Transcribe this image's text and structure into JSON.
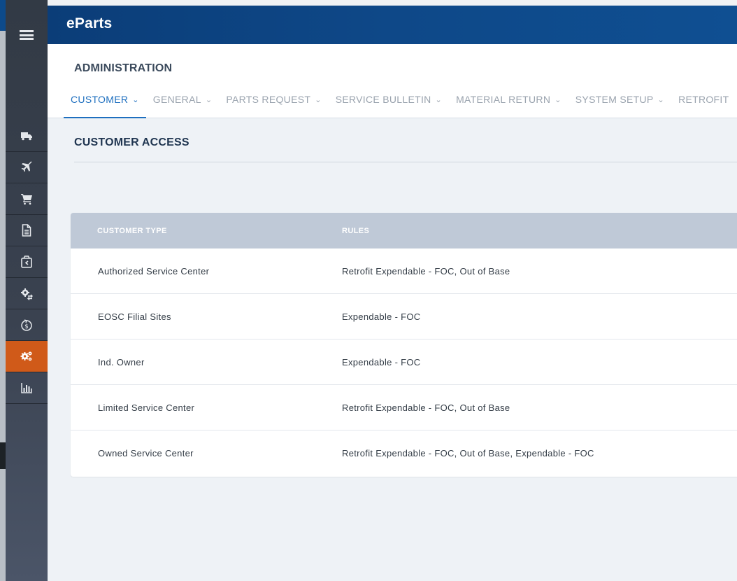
{
  "app": {
    "brand": "eParts"
  },
  "sidebar": {
    "menu_icon": "hamburger-icon",
    "items": [
      {
        "icon": "truck-icon",
        "active": false
      },
      {
        "icon": "airplane-icon",
        "active": false
      },
      {
        "icon": "cart-icon",
        "active": false
      },
      {
        "icon": "document-icon",
        "active": false
      },
      {
        "icon": "box-return-icon",
        "active": false
      },
      {
        "icon": "gear-exchange-icon",
        "active": false
      },
      {
        "icon": "dollar-cycle-icon",
        "active": false
      },
      {
        "icon": "gears-icon",
        "active": true
      },
      {
        "icon": "bar-chart-icon",
        "active": false
      }
    ],
    "active_color": "#d05a19"
  },
  "admin": {
    "title": "ADMINISTRATION",
    "tabs": [
      {
        "label": "CUSTOMER",
        "active": true
      },
      {
        "label": "GENERAL",
        "active": false
      },
      {
        "label": "PARTS REQUEST",
        "active": false
      },
      {
        "label": "SERVICE BULLETIN",
        "active": false
      },
      {
        "label": "MATERIAL RETURN",
        "active": false
      },
      {
        "label": "SYSTEM SETUP",
        "active": false
      },
      {
        "label": "RETROFIT",
        "active": false
      }
    ]
  },
  "section": {
    "title": "CUSTOMER ACCESS"
  },
  "table": {
    "headers": {
      "customer_type": "CUSTOMER TYPE",
      "rules": "RULES"
    },
    "rows": [
      {
        "customer_type": "Authorized Service Center",
        "rules": "Retrofit Expendable - FOC, Out of Base"
      },
      {
        "customer_type": "EOSC Filial Sites",
        "rules": "Expendable - FOC"
      },
      {
        "customer_type": "Ind. Owner",
        "rules": "Expendable - FOC"
      },
      {
        "customer_type": "Limited Service Center",
        "rules": "Retrofit Expendable - FOC, Out of Base"
      },
      {
        "customer_type": "Owned Service Center",
        "rules": "Retrofit Expendable - FOC, Out of Base, Expendable - FOC"
      }
    ]
  },
  "colors": {
    "header_blue": "#0e4888",
    "tab_active": "#1e6fbf",
    "table_header": "#bfc9d7"
  }
}
